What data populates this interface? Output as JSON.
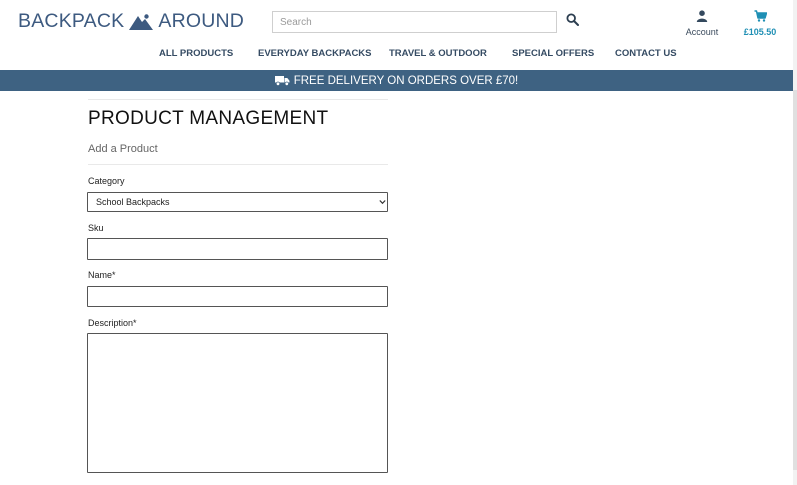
{
  "brand": {
    "name_left": "BACKPACK",
    "name_right": "AROUND"
  },
  "search": {
    "placeholder": "Search",
    "icon": "search-icon"
  },
  "account": {
    "label": "Account",
    "icon": "user-icon"
  },
  "cart": {
    "total": "£105.50",
    "icon": "cart-icon"
  },
  "nav": {
    "items": [
      "ALL PRODUCTS",
      "EVERYDAY BACKPACKS",
      "TRAVEL & OUTDOOR",
      "SPECIAL OFFERS",
      "CONTACT US"
    ]
  },
  "banner": {
    "text": "FREE DELIVERY ON ORDERS OVER £70!",
    "icon": "truck-icon"
  },
  "page": {
    "title": "PRODUCT MANAGEMENT",
    "subtitle": "Add a Product"
  },
  "form": {
    "category_label": "Category",
    "category_value": "School Backpacks",
    "sku_label": "Sku",
    "sku_value": "",
    "name_label": "Name*",
    "name_value": "",
    "description_label": "Description*",
    "description_value": ""
  },
  "colors": {
    "brand": "#3d5a80",
    "banner": "#3e6282",
    "cart_total": "#1f8fb4",
    "nav_text": "#354b63"
  }
}
